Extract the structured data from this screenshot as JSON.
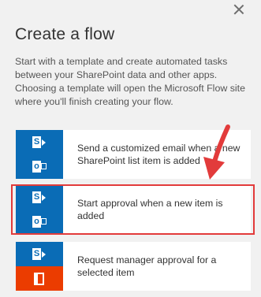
{
  "panel": {
    "title": "Create a flow",
    "description": "Start with a template and create automated tasks between your SharePoint data and other apps. Choosing a template will open the Microsoft Flow site where you'll finish creating your flow."
  },
  "templates": [
    {
      "label": "Send a customized email when a new SharePoint list item is added",
      "top_icon": "sharepoint-icon",
      "bottom_icon": "outlook-icon"
    },
    {
      "label": "Start approval when a new item is added",
      "top_icon": "sharepoint-icon",
      "bottom_icon": "outlook-icon",
      "highlighted": true
    },
    {
      "label": "Request manager approval for a selected item",
      "top_icon": "sharepoint-icon",
      "bottom_icon": "office-icon"
    }
  ],
  "icon_glyphs": {
    "sharepoint": "S",
    "outlook": "o"
  },
  "colors": {
    "app_blue": "#0a6cb6",
    "office_orange": "#eb3c00",
    "annotation_red": "#e23b3b"
  }
}
